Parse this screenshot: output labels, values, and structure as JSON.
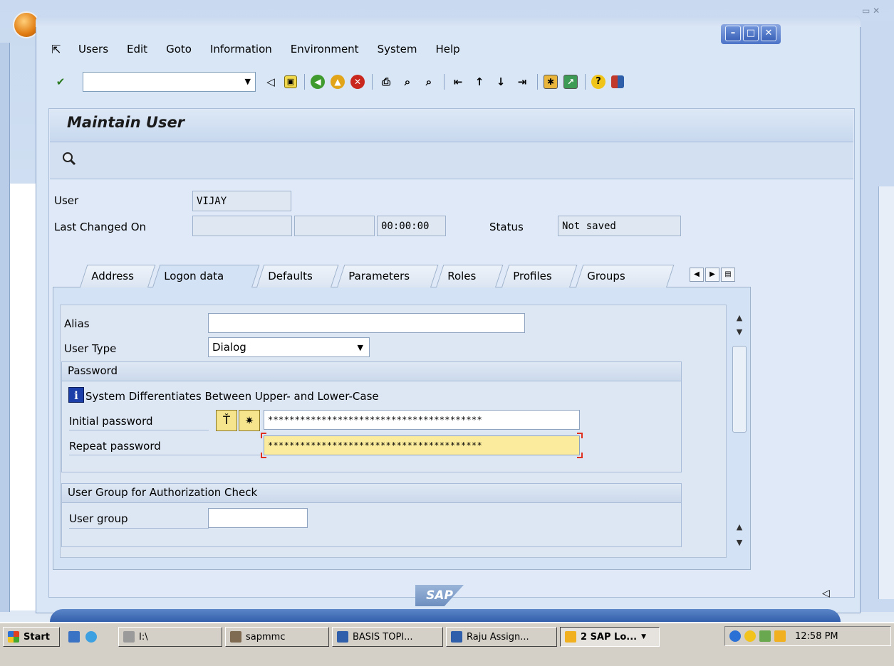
{
  "menu": {
    "items": [
      "Users",
      "Edit",
      "Goto",
      "Information",
      "Environment",
      "System",
      "Help"
    ]
  },
  "toolbar": {
    "command_value": "",
    "icons": [
      "enter-icon",
      "back-arrow-icon",
      "save-icon",
      "back-icon",
      "exit-icon",
      "cancel-icon",
      "print-icon",
      "find-icon",
      "find-next-icon",
      "first-page-icon",
      "previous-page-icon",
      "next-page-icon",
      "last-page-icon",
      "new-session-icon",
      "shortcut-icon",
      "help-icon",
      "customize-layout-icon"
    ]
  },
  "page": {
    "title": "Maintain User"
  },
  "header": {
    "user_label": "User",
    "user_value": "VIJAY",
    "last_changed_label": "Last Changed On",
    "last_changed_date": "",
    "last_changed_by": "",
    "last_changed_time": "00:00:00",
    "status_label": "Status",
    "status_value": "Not saved"
  },
  "tabs": [
    {
      "label": "Address",
      "active": false
    },
    {
      "label": "Logon data",
      "active": true
    },
    {
      "label": "Defaults",
      "active": false
    },
    {
      "label": "Parameters",
      "active": false
    },
    {
      "label": "Roles",
      "active": false
    },
    {
      "label": "Profiles",
      "active": false
    },
    {
      "label": "Groups",
      "active": false
    }
  ],
  "logon": {
    "alias_label": "Alias",
    "alias_value": "",
    "user_type_label": "User Type",
    "user_type_value": "Dialog",
    "password_group_title": "Password",
    "case_info": "System Differentiates Between Upper- and Lower-Case",
    "initial_password_label": "Initial password",
    "initial_password_value": "****************************************",
    "repeat_password_label": "Repeat password",
    "repeat_password_value": "****************************************",
    "auth_group_title": "User Group for Authorization Check",
    "user_group_label": "User group",
    "user_group_value": ""
  },
  "footer": {
    "logo_text": "SAP"
  },
  "taskbar": {
    "start_label": "Start",
    "buttons": [
      {
        "label": "I:\\",
        "pressed": false
      },
      {
        "label": "sapmmc",
        "pressed": false
      },
      {
        "label": "BASIS TOPI...",
        "pressed": false
      },
      {
        "label": "Raju Assign...",
        "pressed": false
      },
      {
        "label": "2 SAP Lo...",
        "pressed": true
      }
    ],
    "clock": "12:58 PM"
  },
  "colors": {
    "menu_bg": "#d9e6f6",
    "panel_bg": "#dfe9f7",
    "tab_area_bg": "#d4e2f6",
    "required_field_bg": "#fbeb9d",
    "required_marker": "#e03020",
    "taskbar_bg": "#d4d0c8"
  }
}
